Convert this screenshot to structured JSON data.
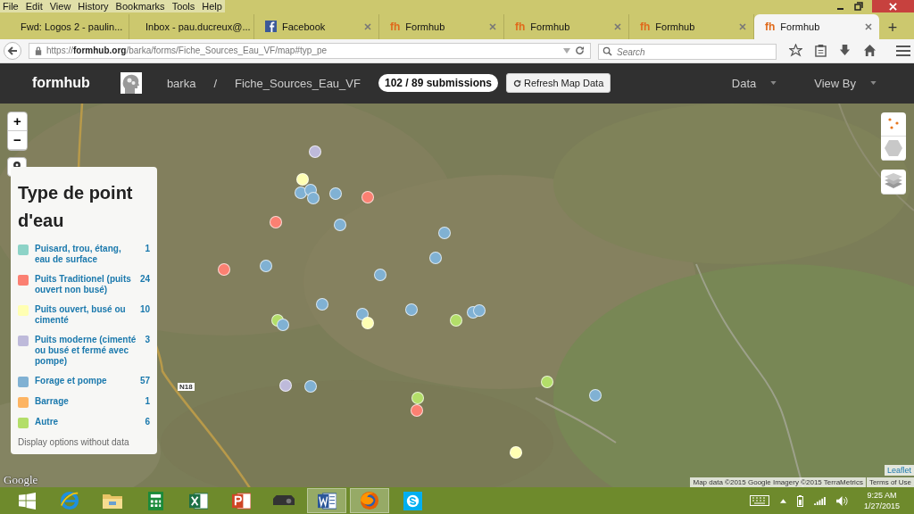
{
  "menu_bar": [
    "File",
    "Edit",
    "View",
    "History",
    "Bookmarks",
    "Tools",
    "Help"
  ],
  "tabs": [
    {
      "title": "Fwd: Logos 2 - paulin...",
      "kind": "gmail",
      "selected": false
    },
    {
      "title": "Inbox - pau.ducreux@...",
      "kind": "gmail",
      "selected": false
    },
    {
      "title": "Facebook",
      "kind": "facebook",
      "selected": false
    },
    {
      "title": "Formhub",
      "kind": "formhub",
      "icon_label": "fh",
      "selected": false
    },
    {
      "title": "Formhub",
      "kind": "formhub",
      "icon_label": "fh",
      "selected": false
    },
    {
      "title": "Formhub",
      "kind": "formhub",
      "icon_label": "fh",
      "selected": false
    },
    {
      "title": "Formhub",
      "kind": "formhub",
      "icon_label": "fh",
      "selected": true
    }
  ],
  "new_tab": "+",
  "address_bar": {
    "url": "https://**formhub.org**/barka/forms/Fiche_Sources_Eau_VF/map#typ_pe"
  },
  "search": {
    "placeholder": "Search"
  },
  "header": {
    "brand": "formhub",
    "user": "barka",
    "separator": "/",
    "form": "Fiche_Sources_Eau_VF",
    "badge": "102 / 89 submissions",
    "refresh_button": "Refresh Map Data",
    "menus": [
      "Data",
      "View By"
    ]
  },
  "map": {
    "zoom_in": "+",
    "zoom_out": "−",
    "road_label": "N18",
    "google": "Google",
    "attribution": "Map data ©2015 Google Imagery ©2015 TerraMetrics",
    "terms": "Terms of Use",
    "leaflet": "Leaflet",
    "markers": [
      {
        "color": "#bebada"
      },
      {
        "color": "#ffffb3"
      },
      {
        "color": "#80b1d3"
      },
      {
        "color": "#80b1d3"
      },
      {
        "color": "#80b1d3"
      },
      {
        "color": "#80b1d3"
      },
      {
        "color": "#fb8072"
      },
      {
        "color": "#fb8072"
      },
      {
        "color": "#80b1d3"
      },
      {
        "color": "#80b1d3"
      },
      {
        "color": "#80b1d3"
      },
      {
        "color": "#fb8072"
      },
      {
        "color": "#80b1d3"
      },
      {
        "color": "#80b1d3"
      },
      {
        "color": "#80b1d3"
      },
      {
        "color": "#80b1d3"
      },
      {
        "color": "#80b1d3"
      },
      {
        "color": "#ffffb3"
      },
      {
        "color": "#b3de69"
      },
      {
        "color": "#80b1d3"
      },
      {
        "color": "#b3de69"
      },
      {
        "color": "#80b1d3"
      },
      {
        "color": "#80b1d3"
      },
      {
        "color": "#bebada"
      },
      {
        "color": "#80b1d3"
      },
      {
        "color": "#b3de69"
      },
      {
        "color": "#80b1d3"
      },
      {
        "color": "#fb8072"
      },
      {
        "color": "#b3de69"
      },
      {
        "color": "#ffffb3"
      }
    ]
  },
  "legend": {
    "title": "Type de point d'eau",
    "items": [
      {
        "label": "Puisard, trou, étang, eau de surface",
        "count": "1",
        "color": "#8dd3c7"
      },
      {
        "label": "Puits Traditionel (puits ouvert non busé)",
        "count": "24",
        "color": "#fb8072"
      },
      {
        "label": "Puits ouvert, busé ou cimenté",
        "count": "10",
        "color": "#ffffb3"
      },
      {
        "label": "Puits moderne (cimenté ou busé et fermé avec pompe)",
        "count": "3",
        "color": "#bebada"
      },
      {
        "label": "Forage et pompe",
        "count": "57",
        "color": "#80b1d3"
      },
      {
        "label": "Barrage",
        "count": "1",
        "color": "#fdb462"
      },
      {
        "label": "Autre",
        "count": "6",
        "color": "#b3de69"
      }
    ],
    "footer": "Display options without data"
  },
  "taskbar": {
    "apps": [
      {
        "kind": "windows",
        "selected": false
      },
      {
        "kind": "ie",
        "selected": false
      },
      {
        "kind": "explorer",
        "selected": false
      },
      {
        "kind": "calculator",
        "selected": false
      },
      {
        "kind": "excel",
        "selected": false
      },
      {
        "kind": "powerpoint",
        "selected": false
      },
      {
        "kind": "projector",
        "selected": false
      },
      {
        "kind": "word",
        "selected": true
      },
      {
        "kind": "firefox",
        "selected": true
      },
      {
        "kind": "skype",
        "selected": false
      }
    ],
    "time": "9:25 AM",
    "date": "1/27/2015"
  }
}
